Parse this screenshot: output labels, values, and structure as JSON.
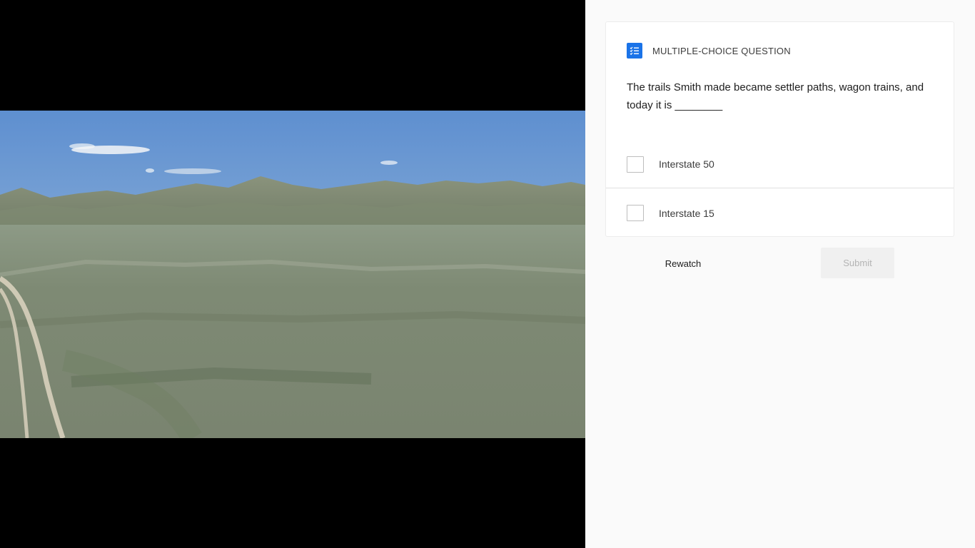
{
  "video": {
    "scene": "grassland-hills"
  },
  "question": {
    "type_label": "MULTIPLE-CHOICE QUESTION",
    "type_icon": "checklist-icon",
    "text": "The trails Smith made became settler paths, wagon trains, and today it is ________",
    "options": [
      {
        "label": "Interstate 50",
        "checked": false
      },
      {
        "label": "Interstate 15",
        "checked": false
      }
    ]
  },
  "actions": {
    "rewatch_label": "Rewatch",
    "submit_label": "Submit",
    "submit_enabled": false
  },
  "colors": {
    "accent": "#1a73e8",
    "video_background": "#000000",
    "panel_background": "#fafafa"
  }
}
